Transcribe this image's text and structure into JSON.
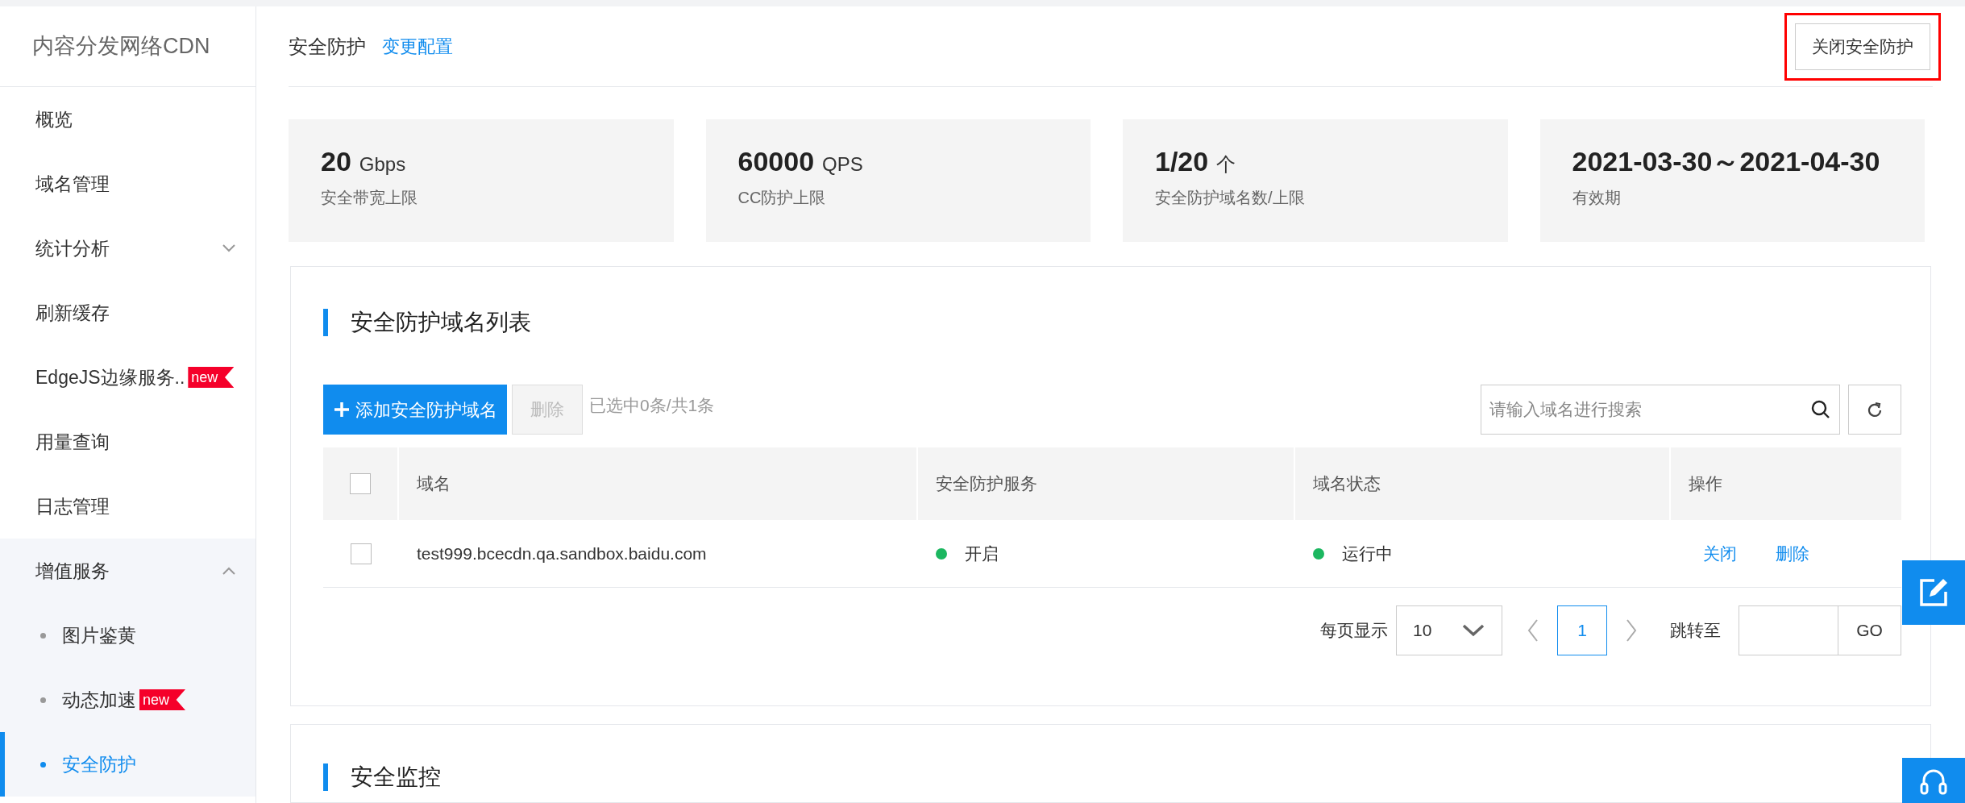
{
  "sidebar": {
    "title": "内容分发网络CDN",
    "items": [
      {
        "label": "概览"
      },
      {
        "label": "域名管理"
      },
      {
        "label": "统计分析",
        "expanded": false
      },
      {
        "label": "刷新缓存"
      },
      {
        "label": "EdgeJS边缘服务..",
        "badge": "new"
      },
      {
        "label": "用量查询"
      },
      {
        "label": "日志管理"
      },
      {
        "label": "增值服务",
        "expanded": true,
        "children": [
          {
            "label": "图片鉴黄",
            "selected": false
          },
          {
            "label": "动态加速",
            "selected": false,
            "badge": "new"
          },
          {
            "label": "安全防护",
            "selected": true
          }
        ]
      }
    ]
  },
  "header": {
    "title": "安全防护",
    "link": "变更配置",
    "button": "关闭安全防护"
  },
  "stats": [
    {
      "value": "20",
      "unit": "Gbps",
      "label": "安全带宽上限"
    },
    {
      "value": "60000",
      "unit": "QPS",
      "label": "CC防护上限"
    },
    {
      "value": "1/20",
      "unit": "个",
      "label": "安全防护域名数/上限"
    },
    {
      "value": "2021-03-30～2021-04-30",
      "label": "有效期"
    }
  ],
  "domain_list": {
    "title": "安全防护域名列表",
    "add_button": "添加安全防护域名",
    "delete_button": "删除",
    "delete_disabled": true,
    "selection_info": "已选中0条/共1条",
    "search": {
      "placeholder": "请输入域名进行搜索"
    },
    "select_all_checked": false,
    "columns": [
      "域名",
      "安全防护服务",
      "域名状态",
      "操作"
    ],
    "rows": [
      {
        "checked": false,
        "domain": "test999.bcecdn.qa.sandbox.baidu.com",
        "service": {
          "label": "开启",
          "color": "#1cb760"
        },
        "status": {
          "label": "运行中",
          "color": "#1cb760"
        },
        "actions": [
          "关闭",
          "删除"
        ]
      }
    ],
    "pagination": {
      "page_size_label": "每页显示",
      "page_size": "10",
      "pages": [
        {
          "label": "1",
          "selected": true
        }
      ],
      "jump_label": "跳转至",
      "go": "GO"
    }
  },
  "monitor": {
    "title": "安全监控"
  }
}
